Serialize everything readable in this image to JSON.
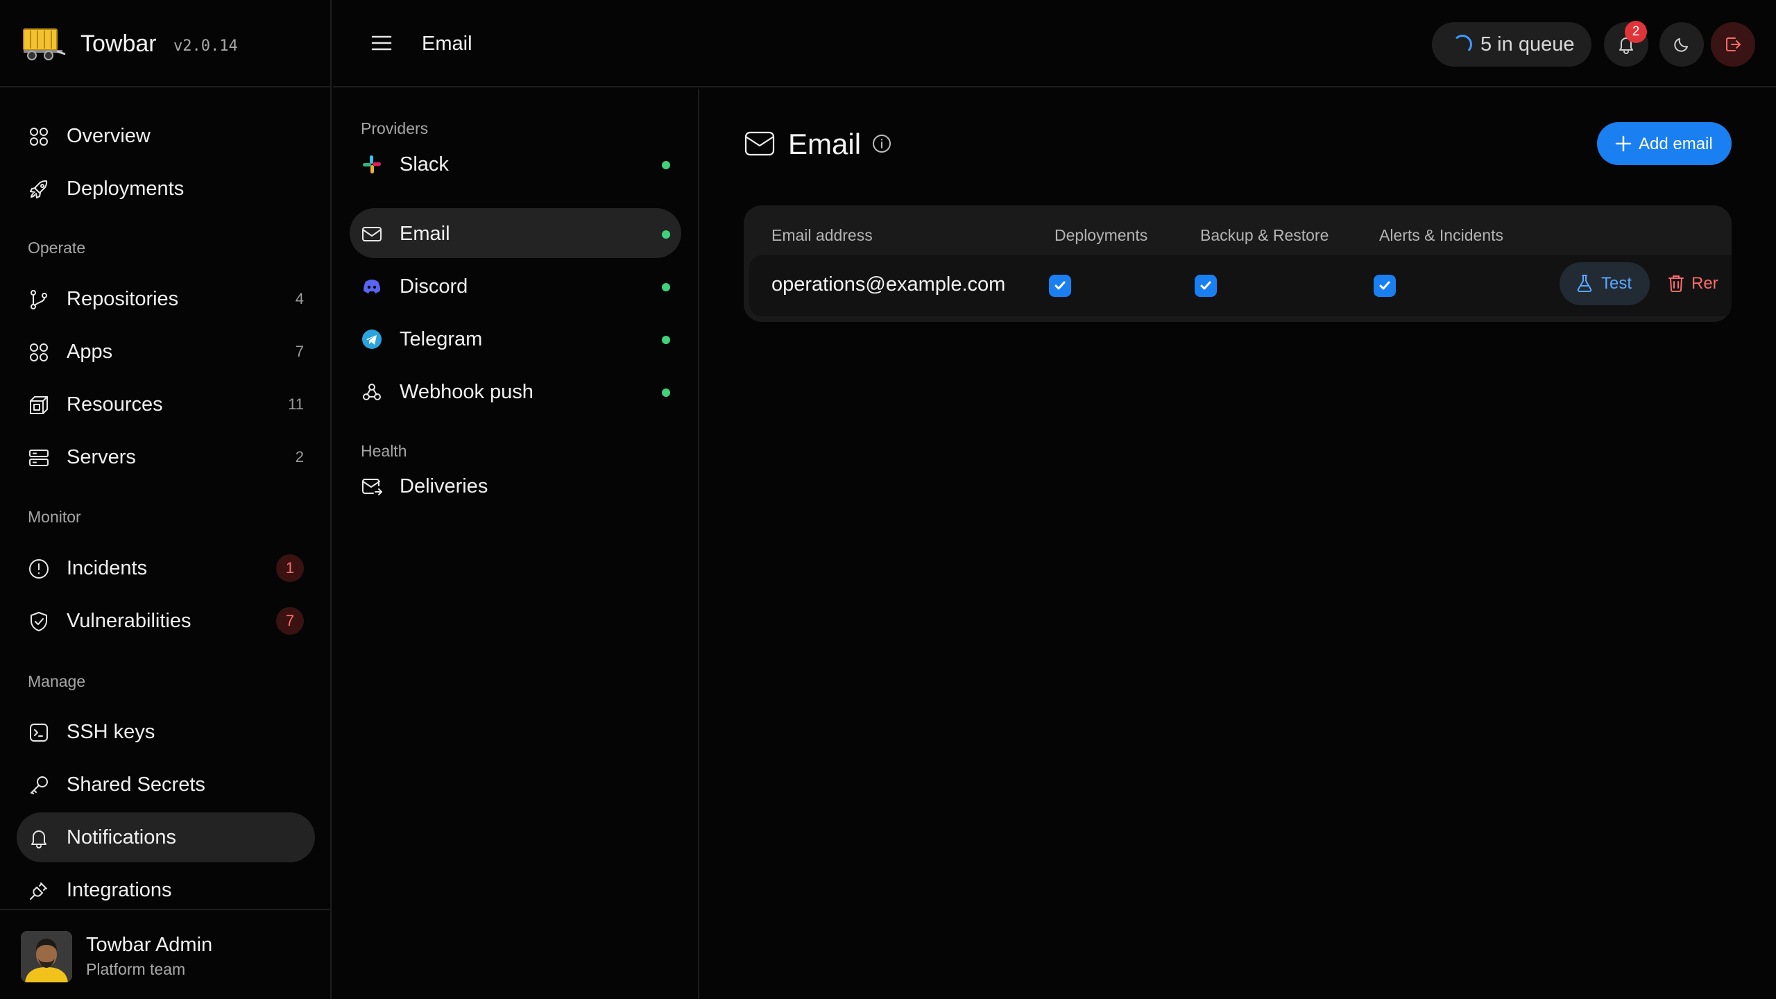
{
  "brand": {
    "name": "Towbar",
    "version": "v2.0.14",
    "logo_icon": "truck-trailer-icon"
  },
  "sidebar": {
    "primary": [
      {
        "label": "Overview",
        "icon": "grid-icon"
      },
      {
        "label": "Deployments",
        "icon": "rocket-icon"
      }
    ],
    "operate": {
      "heading": "Operate",
      "items": [
        {
          "label": "Repositories",
          "count": "4",
          "icon": "git-branch-icon"
        },
        {
          "label": "Apps",
          "count": "7",
          "icon": "grid-icon"
        },
        {
          "label": "Resources",
          "count": "11",
          "icon": "cube-icon"
        },
        {
          "label": "Servers",
          "count": "2",
          "icon": "server-icon"
        }
      ]
    },
    "monitor": {
      "heading": "Monitor",
      "items": [
        {
          "label": "Incidents",
          "count": "1",
          "icon": "alert-circle-icon"
        },
        {
          "label": "Vulnerabilities",
          "count": "7",
          "icon": "shield-check-icon"
        }
      ]
    },
    "manage": {
      "heading": "Manage",
      "items": [
        {
          "label": "SSH keys",
          "icon": "terminal-icon"
        },
        {
          "label": "Shared Secrets",
          "icon": "key-icon"
        },
        {
          "label": "Notifications",
          "icon": "bell-icon",
          "active": true
        },
        {
          "label": "Integrations",
          "icon": "plug-icon"
        }
      ]
    },
    "user": {
      "name": "Towbar Admin",
      "team": "Platform team"
    }
  },
  "topbar": {
    "title": "Email",
    "queue_label": "5 in queue",
    "notification_count": "2"
  },
  "subnav": {
    "providers_heading": "Providers",
    "providers": [
      {
        "label": "Slack",
        "icon": "slack-icon",
        "status": "connected"
      },
      {
        "label": "Email",
        "icon": "mail-icon",
        "status": "connected",
        "active": true
      },
      {
        "label": "Discord",
        "icon": "discord-icon",
        "status": "connected"
      },
      {
        "label": "Telegram",
        "icon": "telegram-icon",
        "status": "connected"
      },
      {
        "label": "Webhook push",
        "icon": "webhook-icon",
        "status": "connected"
      }
    ],
    "health_heading": "Health",
    "health": [
      {
        "label": "Deliveries",
        "icon": "mail-send-icon"
      }
    ]
  },
  "main": {
    "title": "Email",
    "add_button_label": "Add email",
    "table": {
      "columns": [
        "Email address",
        "Deployments",
        "Backup & Restore",
        "Alerts & Incidents"
      ],
      "rows": [
        {
          "email": "operations@example.com",
          "deployments": true,
          "backup_restore": true,
          "alerts_incidents": true,
          "test_label": "Test",
          "remove_label": "Rer"
        }
      ]
    }
  },
  "colors": {
    "accent": "#1a7ff0",
    "status_ok": "#3fd27a",
    "danger": "#ff6b6b",
    "background": "#050505"
  }
}
